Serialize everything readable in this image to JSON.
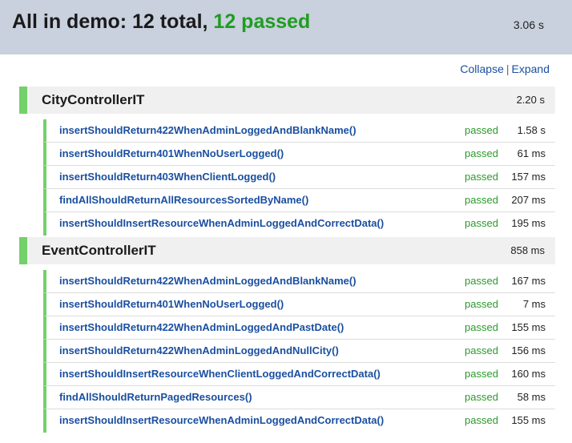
{
  "header": {
    "title_prefix": "All in demo: 12 total, ",
    "title_passed": "12 passed",
    "duration": "3.06 s"
  },
  "controls": {
    "collapse_label": "Collapse",
    "separator": "|",
    "expand_label": "Expand"
  },
  "colors": {
    "header_bg": "#c9d0de",
    "passed_green": "#1f9d1f",
    "status_bar_green": "#74d06a",
    "link_blue": "#1a4fa0"
  },
  "suites": [
    {
      "name": "CityControllerIT",
      "duration": "2.20 s",
      "tests": [
        {
          "name": "insertShouldReturn422WhenAdminLoggedAndBlankName()",
          "status": "passed",
          "time": "1.58 s"
        },
        {
          "name": "insertShouldReturn401WhenNoUserLogged()",
          "status": "passed",
          "time": "61 ms"
        },
        {
          "name": "insertShouldReturn403WhenClientLogged()",
          "status": "passed",
          "time": "157 ms"
        },
        {
          "name": "findAllShouldReturnAllResourcesSortedByName()",
          "status": "passed",
          "time": "207 ms"
        },
        {
          "name": "insertShouldInsertResourceWhenAdminLoggedAndCorrectData()",
          "status": "passed",
          "time": "195 ms"
        }
      ]
    },
    {
      "name": "EventControllerIT",
      "duration": "858 ms",
      "tests": [
        {
          "name": "insertShouldReturn422WhenAdminLoggedAndBlankName()",
          "status": "passed",
          "time": "167 ms"
        },
        {
          "name": "insertShouldReturn401WhenNoUserLogged()",
          "status": "passed",
          "time": "7 ms"
        },
        {
          "name": "insertShouldReturn422WhenAdminLoggedAndPastDate()",
          "status": "passed",
          "time": "155 ms"
        },
        {
          "name": "insertShouldReturn422WhenAdminLoggedAndNullCity()",
          "status": "passed",
          "time": "156 ms"
        },
        {
          "name": "insertShouldInsertResourceWhenClientLoggedAndCorrectData()",
          "status": "passed",
          "time": "160 ms"
        },
        {
          "name": "findAllShouldReturnPagedResources()",
          "status": "passed",
          "time": "58 ms"
        },
        {
          "name": "insertShouldInsertResourceWhenAdminLoggedAndCorrectData()",
          "status": "passed",
          "time": "155 ms"
        }
      ]
    }
  ]
}
